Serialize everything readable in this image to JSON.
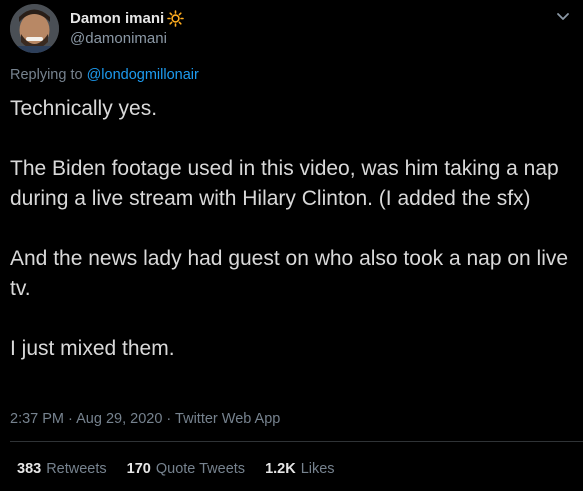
{
  "author": {
    "display_name": "Damon imani",
    "handle": "@damonimani",
    "badge_icon": "sun-icon"
  },
  "reply": {
    "prefix": "Replying to",
    "mention": "@londogmillonair"
  },
  "tweet": {
    "paragraphs": [
      "Technically yes.",
      "The Biden footage used in this video, was him taking a nap during a live stream with Hilary Clinton. (I added the sfx)",
      "And the news lady had guest on who also took a nap on live tv.",
      "I just mixed them."
    ]
  },
  "meta": {
    "time": "2:37 PM",
    "separator1": "·",
    "date": "Aug 29, 2020",
    "separator2": "·",
    "source": "Twitter Web App"
  },
  "stats": {
    "retweets_count": "383",
    "retweets_label": "Retweets",
    "quotes_count": "170",
    "quotes_label": "Quote Tweets",
    "likes_count": "1.2K",
    "likes_label": "Likes"
  },
  "colors": {
    "background": "#000000",
    "text": "#d9d9d9",
    "secondary": "#76828e",
    "link": "#1d9bf0",
    "badge": "#ffad1f"
  }
}
